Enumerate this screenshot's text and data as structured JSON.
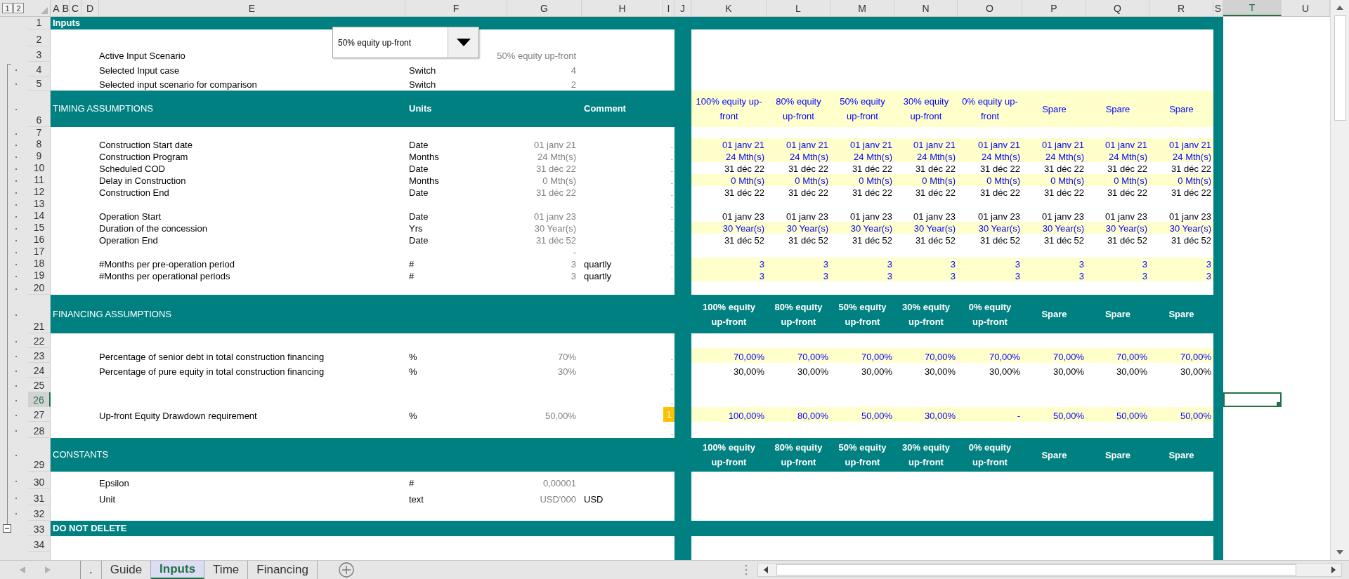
{
  "outline_levels": [
    "1",
    "2"
  ],
  "columns": [
    {
      "label": "A",
      "selected": false
    },
    {
      "label": "B",
      "selected": false
    },
    {
      "label": "C",
      "selected": false
    },
    {
      "label": "D",
      "selected": false
    },
    {
      "label": "E",
      "selected": false
    },
    {
      "label": "F",
      "selected": false
    },
    {
      "label": "G",
      "selected": false
    },
    {
      "label": "H",
      "selected": false
    },
    {
      "label": "I",
      "selected": false
    },
    {
      "label": "J",
      "selected": false
    },
    {
      "label": "K",
      "selected": false
    },
    {
      "label": "L",
      "selected": false
    },
    {
      "label": "M",
      "selected": false
    },
    {
      "label": "N",
      "selected": false
    },
    {
      "label": "O",
      "selected": false
    },
    {
      "label": "P",
      "selected": false
    },
    {
      "label": "Q",
      "selected": false
    },
    {
      "label": "R",
      "selected": false
    },
    {
      "label": "S",
      "selected": false
    },
    {
      "label": "T",
      "selected": true
    },
    {
      "label": "U",
      "selected": false
    }
  ],
  "scenario_dropdown": {
    "value": "50% equity up-front"
  },
  "rows": [
    {
      "number": "1",
      "kind": "band",
      "bold": true,
      "grouped": false,
      "toggle": false,
      "selected": false,
      "input": false,
      "label": "Inputs"
    },
    {
      "number": "2",
      "kind": "row",
      "grouped": false,
      "toggle": false,
      "selected": false,
      "input": false
    },
    {
      "number": "3",
      "kind": "row",
      "grouped": false,
      "toggle": false,
      "selected": false,
      "input": false,
      "label": "Active Input Scenario",
      "value": "50% equity up-front"
    },
    {
      "number": "4",
      "kind": "row",
      "grouped": true,
      "toggle": false,
      "selected": false,
      "input": false,
      "label": "Selected Input case",
      "unit": "Switch",
      "value": "4"
    },
    {
      "number": "5",
      "kind": "row",
      "grouped": true,
      "toggle": false,
      "selected": false,
      "input": false,
      "label": "Selected input scenario for comparison",
      "unit": "Switch",
      "value": "2"
    },
    {
      "number": "6",
      "kind": "band",
      "bold": false,
      "grouped": true,
      "toggle": false,
      "selected": false,
      "input": true,
      "label": "TIMING ASSUMPTIONS",
      "unit": "Units",
      "comment": "Comment",
      "cases": [
        "100% equity up-front",
        "80% equity up-front",
        "50% equity up-front",
        "30% equity up-front",
        "0% equity up-front",
        "Spare",
        "Spare",
        "Spare"
      ]
    },
    {
      "number": "7",
      "kind": "row",
      "grouped": true,
      "toggle": false,
      "selected": false,
      "input": false
    },
    {
      "number": "8",
      "kind": "row",
      "grouped": true,
      "toggle": false,
      "selected": false,
      "input": true,
      "label": "Construction Start date",
      "unit": "Date",
      "value": "01 janv 21",
      "flag": {
        "text": "-",
        "alert": false
      },
      "cases": [
        "01 janv 21",
        "01 janv 21",
        "01 janv 21",
        "01 janv 21",
        "01 janv 21",
        "01 janv 21",
        "01 janv 21",
        "01 janv 21"
      ]
    },
    {
      "number": "9",
      "kind": "row",
      "grouped": true,
      "toggle": false,
      "selected": false,
      "input": true,
      "label": "Construction Program",
      "unit": "Months",
      "value": "24 Mth(s)",
      "flag": {
        "text": "-",
        "alert": false
      },
      "cases": [
        "24 Mth(s)",
        "24 Mth(s)",
        "24 Mth(s)",
        "24 Mth(s)",
        "24 Mth(s)",
        "24 Mth(s)",
        "24 Mth(s)",
        "24 Mth(s)"
      ]
    },
    {
      "number": "10",
      "kind": "row",
      "grouped": true,
      "toggle": false,
      "selected": false,
      "input": false,
      "label": "Scheduled COD",
      "unit": "Date",
      "value": "31 déc 22",
      "flag": {
        "text": "-",
        "alert": false
      },
      "cases": [
        "31 déc 22",
        "31 déc 22",
        "31 déc 22",
        "31 déc 22",
        "31 déc 22",
        "31 déc 22",
        "31 déc 22",
        "31 déc 22"
      ]
    },
    {
      "number": "11",
      "kind": "row",
      "grouped": true,
      "toggle": false,
      "selected": false,
      "input": true,
      "label": "Delay in Construction",
      "unit": "Months",
      "value": "0 Mth(s)",
      "flag": {
        "text": "-",
        "alert": false
      },
      "cases": [
        "0 Mth(s)",
        "0 Mth(s)",
        "0 Mth(s)",
        "0 Mth(s)",
        "0 Mth(s)",
        "0 Mth(s)",
        "0 Mth(s)",
        "0 Mth(s)"
      ]
    },
    {
      "number": "12",
      "kind": "row",
      "grouped": true,
      "toggle": false,
      "selected": false,
      "input": false,
      "label": "Construction End",
      "unit": "Date",
      "value": "31 déc 22",
      "flag": {
        "text": "-",
        "alert": false
      },
      "cases": [
        "31 déc 22",
        "31 déc 22",
        "31 déc 22",
        "31 déc 22",
        "31 déc 22",
        "31 déc 22",
        "31 déc 22",
        "31 déc 22"
      ]
    },
    {
      "number": "13",
      "kind": "row",
      "grouped": true,
      "toggle": false,
      "selected": false,
      "input": false,
      "flag": {
        "text": "-",
        "alert": false
      }
    },
    {
      "number": "14",
      "kind": "row",
      "grouped": true,
      "toggle": false,
      "selected": false,
      "input": false,
      "label": "Operation Start",
      "unit": "Date",
      "value": "01 janv 23",
      "flag": {
        "text": "-",
        "alert": false
      },
      "cases": [
        "01 janv 23",
        "01 janv 23",
        "01 janv 23",
        "01 janv 23",
        "01 janv 23",
        "01 janv 23",
        "01 janv 23",
        "01 janv 23"
      ]
    },
    {
      "number": "15",
      "kind": "row",
      "grouped": true,
      "toggle": false,
      "selected": false,
      "input": true,
      "label": "Duration of the concession",
      "unit": "Yrs",
      "value": "30 Year(s)",
      "flag": {
        "text": "-",
        "alert": false
      },
      "cases": [
        "30 Year(s)",
        "30 Year(s)",
        "30 Year(s)",
        "30 Year(s)",
        "30 Year(s)",
        "30 Year(s)",
        "30 Year(s)",
        "30 Year(s)"
      ]
    },
    {
      "number": "16",
      "kind": "row",
      "grouped": true,
      "toggle": false,
      "selected": false,
      "input": false,
      "label": "Operation End",
      "unit": "Date",
      "value": "31 déc 52",
      "flag": {
        "text": "-",
        "alert": false
      },
      "cases": [
        "31 déc 52",
        "31 déc 52",
        "31 déc 52",
        "31 déc 52",
        "31 déc 52",
        "31 déc 52",
        "31 déc 52",
        "31 déc 52"
      ]
    },
    {
      "number": "17",
      "kind": "row",
      "grouped": true,
      "toggle": false,
      "selected": false,
      "input": false,
      "value": "-",
      "flag": {
        "text": "-",
        "alert": false
      }
    },
    {
      "number": "18",
      "kind": "row",
      "grouped": true,
      "toggle": false,
      "selected": false,
      "input": true,
      "label": "#Months per pre-operation period",
      "unit": "#",
      "value": "3",
      "comment": "quartly",
      "flag": {
        "text": "-",
        "alert": false
      },
      "cases": [
        "3",
        "3",
        "3",
        "3",
        "3",
        "3",
        "3",
        "3"
      ]
    },
    {
      "number": "19",
      "kind": "row",
      "grouped": true,
      "toggle": false,
      "selected": false,
      "input": true,
      "label": "#Months per operational periods",
      "unit": "#",
      "value": "3",
      "comment": "quartly",
      "flag": {
        "text": "-",
        "alert": false
      },
      "cases": [
        "3",
        "3",
        "3",
        "3",
        "3",
        "3",
        "3",
        "3"
      ]
    },
    {
      "number": "20",
      "kind": "row",
      "grouped": true,
      "toggle": false,
      "selected": false,
      "input": false
    },
    {
      "number": "21",
      "kind": "band",
      "bold": false,
      "grouped": true,
      "toggle": false,
      "selected": false,
      "input": false,
      "label": "FINANCING ASSUMPTIONS",
      "cases": [
        "100% equity up-front",
        "80% equity up-front",
        "50% equity up-front",
        "30% equity up-front",
        "0% equity up-front",
        "Spare",
        "Spare",
        "Spare"
      ]
    },
    {
      "number": "22",
      "kind": "row",
      "grouped": true,
      "toggle": false,
      "selected": false,
      "input": false
    },
    {
      "number": "23",
      "kind": "row",
      "grouped": true,
      "toggle": false,
      "selected": false,
      "input": true,
      "label": "Percentage of senior debt in total construction financing",
      "unit": "%",
      "value": "70%",
      "flag": {
        "text": "-",
        "alert": false
      },
      "cases": [
        "70,00%",
        "70,00%",
        "70,00%",
        "70,00%",
        "70,00%",
        "70,00%",
        "70,00%",
        "70,00%"
      ]
    },
    {
      "number": "24",
      "kind": "row",
      "grouped": true,
      "toggle": false,
      "selected": false,
      "input": false,
      "label": "Percentage of pure equity in total construction financing",
      "unit": "%",
      "value": "30%",
      "flag": {
        "text": "-",
        "alert": false
      },
      "cases": [
        "30,00%",
        "30,00%",
        "30,00%",
        "30,00%",
        "30,00%",
        "30,00%",
        "30,00%",
        "30,00%"
      ]
    },
    {
      "number": "25",
      "kind": "row",
      "grouped": true,
      "toggle": false,
      "selected": false,
      "input": false,
      "flag": {
        "text": "-",
        "alert": false
      }
    },
    {
      "number": "26",
      "kind": "row",
      "grouped": true,
      "toggle": false,
      "selected": true,
      "input": false,
      "flag": {
        "text": "-",
        "alert": false
      }
    },
    {
      "number": "27",
      "kind": "row",
      "grouped": true,
      "toggle": false,
      "selected": false,
      "input": true,
      "label": "Up-front Equity Drawdown requirement",
      "unit": "%",
      "value": "50,00%",
      "flag": {
        "text": "1",
        "alert": true
      },
      "cases": [
        "100,00%",
        "80,00%",
        "50,00%",
        "30,00%",
        "-",
        "50,00%",
        "50,00%",
        "50,00%"
      ]
    },
    {
      "number": "28",
      "kind": "row",
      "grouped": true,
      "toggle": false,
      "selected": false,
      "input": false,
      "flag": {
        "text": "-",
        "alert": false
      }
    },
    {
      "number": "29",
      "kind": "band",
      "bold": false,
      "grouped": true,
      "toggle": false,
      "selected": false,
      "input": false,
      "label": "CONSTANTS",
      "cases": [
        "100% equity up-front",
        "80% equity up-front",
        "50% equity up-front",
        "30% equity up-front",
        "0% equity up-front",
        "Spare",
        "Spare",
        "Spare"
      ]
    },
    {
      "number": "30",
      "kind": "row",
      "grouped": true,
      "toggle": false,
      "selected": false,
      "input": false,
      "label": "Epsilon",
      "unit": "#",
      "value": "0,00001"
    },
    {
      "number": "31",
      "kind": "row",
      "grouped": true,
      "toggle": false,
      "selected": false,
      "input": false,
      "label": "Unit",
      "unit": "text",
      "value": "USD'000",
      "comment": "USD"
    },
    {
      "number": "32",
      "kind": "row",
      "grouped": true,
      "toggle": false,
      "selected": false,
      "input": false
    },
    {
      "number": "33",
      "kind": "band",
      "bold": true,
      "grouped": true,
      "toggle": true,
      "selected": false,
      "input": false,
      "label": "DO NOT DELETE"
    },
    {
      "number": "34",
      "kind": "row",
      "grouped": false,
      "toggle": false,
      "selected": false,
      "input": false
    },
    {
      "kind": "row",
      "grouped": false,
      "toggle": false,
      "selected": false,
      "input": false
    }
  ],
  "sheet_tabs": [
    {
      "label": ".",
      "selected": false
    },
    {
      "label": "Guide",
      "selected": false
    },
    {
      "label": "Inputs",
      "selected": true
    },
    {
      "label": "Time",
      "selected": false
    },
    {
      "label": "Financing",
      "selected": false
    }
  ]
}
